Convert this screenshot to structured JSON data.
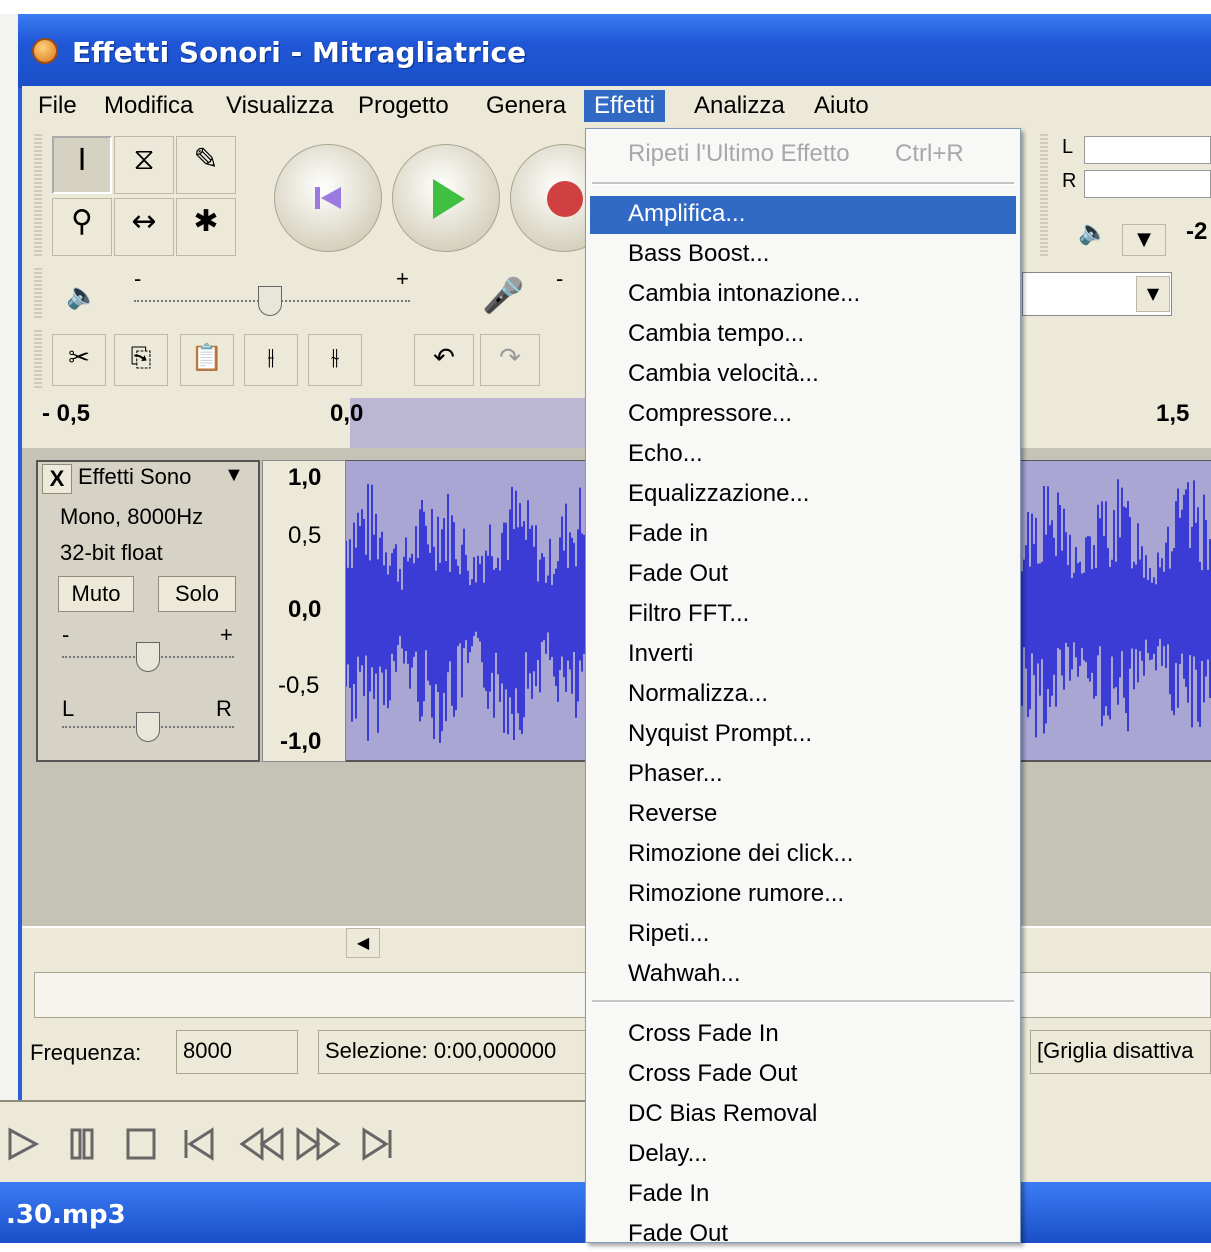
{
  "window": {
    "title": "Effetti Sonori - Mitragliatrice"
  },
  "menubar": {
    "items": [
      {
        "label": "File"
      },
      {
        "label": "Modifica"
      },
      {
        "label": "Visualizza"
      },
      {
        "label": "Progetto"
      },
      {
        "label": "Genera"
      },
      {
        "label": "Effetti",
        "active": true
      },
      {
        "label": "Analizza"
      },
      {
        "label": "Aiuto"
      }
    ]
  },
  "toolbar": {
    "tools_row1": [
      "I",
      "⧖",
      "✎"
    ],
    "tools_row2": [
      "⚲",
      "↔",
      "✱"
    ],
    "volume_minus": "-",
    "volume_plus": "+",
    "mic_minus": "-",
    "meter_left": "L",
    "meter_right": "R",
    "meter_number": "-2"
  },
  "ruler": {
    "labels": [
      "- 0,5",
      "0,0",
      "1,5"
    ]
  },
  "track": {
    "name": "Effetti Sono",
    "close": "X",
    "arrow": "▼",
    "info_line1": "Mono, 8000Hz",
    "info_line2": "32-bit float",
    "mute_label": "Muto",
    "solo_label": "Solo",
    "gain_minus": "-",
    "gain_plus": "+",
    "pan_left": "L",
    "pan_right": "R",
    "scale": [
      "1,0",
      "0,5",
      "0,0",
      "-0,5",
      "-1,0"
    ]
  },
  "status": {
    "frequency_label": "Frequenza:",
    "frequency_value": "8000",
    "selection_text": "Selezione: 0:00,000000",
    "grid_text": "[Griglia disattiva"
  },
  "file_bar": {
    "text": ".30.mp3"
  },
  "effects_menu": {
    "repeat_last": "Ripeti l'Ultimo Effetto",
    "repeat_shortcut": "Ctrl+R",
    "group1": [
      "Amplifica...",
      "Bass Boost...",
      "Cambia intonazione...",
      "Cambia tempo...",
      "Cambia velocità...",
      "Compressore...",
      "Echo...",
      "Equalizzazione...",
      "Fade in",
      "Fade Out",
      "Filtro FFT...",
      "Inverti",
      "Normalizza...",
      "Nyquist Prompt...",
      "Phaser...",
      "Reverse",
      "Rimozione dei click...",
      "Rimozione rumore...",
      "Ripeti...",
      "Wahwah..."
    ],
    "group2": [
      "Cross Fade In",
      "Cross Fade Out",
      "DC Bias Removal",
      "Delay...",
      "Fade In",
      "Fade Out"
    ],
    "highlighted": "Amplifica..."
  },
  "colors": {
    "title_bar": "#1f57d6",
    "menu_highlight": "#316ac5",
    "waveform": "#3b3bd6",
    "selection": "#a9a6d4"
  }
}
